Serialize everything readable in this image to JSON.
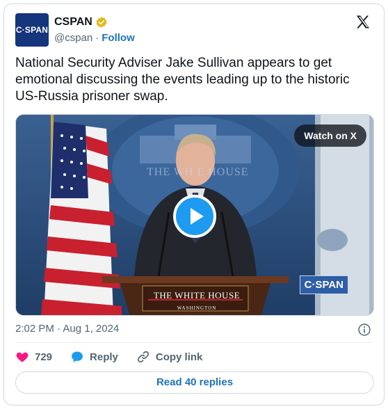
{
  "account": {
    "avatar_text": "C·SPAN",
    "display_name": "CSPAN",
    "handle": "@cspan",
    "separator": "·",
    "follow_label": "Follow"
  },
  "tweet": {
    "text": "National Security Adviser Jake Sullivan appears to get emotional discussing the events leading up to the historic US-Russia prisoner swap.",
    "timestamp": "2:02 PM · Aug 1, 2024"
  },
  "media": {
    "watch_label": "Watch on X",
    "building_text": "THE WH  E HOUSE",
    "podium_title": "THE WHITE HOUSE",
    "podium_subtitle": "WASHINGTON",
    "network_bug": "C·SPAN"
  },
  "actions": {
    "likes_count": "729",
    "reply_label": "Reply",
    "copy_link_label": "Copy link"
  },
  "read_replies_label": "Read 40 replies",
  "colors": {
    "brand": "#1d9bf0",
    "follow_link": "#1d74ba",
    "like_heart": "#f91880",
    "avatar_bg": "#15357c"
  },
  "icons": [
    "verified-badge-icon",
    "x-logo-icon",
    "play-icon",
    "info-icon",
    "heart-icon",
    "reply-bubble-icon",
    "link-icon"
  ]
}
